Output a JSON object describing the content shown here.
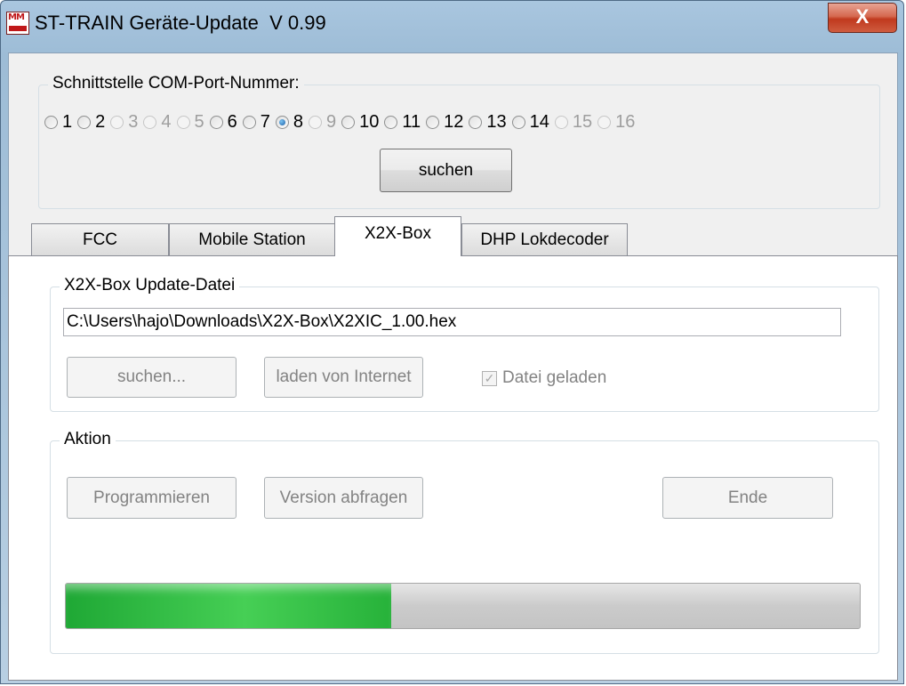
{
  "window": {
    "title": "ST-TRAIN Geräte-Update  V 0.99",
    "close_label": "X",
    "icon_text": "MM"
  },
  "com": {
    "group_label": "Schnittstelle COM-Port-Nummer:",
    "ports": [
      {
        "label": "1",
        "enabled": true,
        "checked": false
      },
      {
        "label": "2",
        "enabled": true,
        "checked": false
      },
      {
        "label": "3",
        "enabled": false,
        "checked": false
      },
      {
        "label": "4",
        "enabled": false,
        "checked": false
      },
      {
        "label": "5",
        "enabled": false,
        "checked": false
      },
      {
        "label": "6",
        "enabled": true,
        "checked": false
      },
      {
        "label": "7",
        "enabled": true,
        "checked": false
      },
      {
        "label": "8",
        "enabled": true,
        "checked": true
      },
      {
        "label": "9",
        "enabled": false,
        "checked": false
      },
      {
        "label": "10",
        "enabled": true,
        "checked": false
      },
      {
        "label": "11",
        "enabled": true,
        "checked": false
      },
      {
        "label": "12",
        "enabled": true,
        "checked": false
      },
      {
        "label": "13",
        "enabled": true,
        "checked": false
      },
      {
        "label": "14",
        "enabled": true,
        "checked": false
      },
      {
        "label": "15",
        "enabled": false,
        "checked": false
      },
      {
        "label": "16",
        "enabled": false,
        "checked": false
      }
    ],
    "search_label": "suchen"
  },
  "tabs": [
    {
      "label": "FCC",
      "active": false
    },
    {
      "label": "Mobile Station",
      "active": false
    },
    {
      "label": "X2X-Box",
      "active": true
    },
    {
      "label": "DHP Lokdecoder",
      "active": false
    }
  ],
  "update_file": {
    "group_label": "X2X-Box Update-Datei",
    "path": "C:\\Users\\hajo\\Downloads\\X2X-Box\\X2XIC_1.00.hex",
    "search_label": "suchen...",
    "internet_label": "laden von Internet",
    "loaded_label": "Datei geladen",
    "loaded_checked": true
  },
  "action": {
    "group_label": "Aktion",
    "program_label": "Programmieren",
    "version_label": "Version abfragen",
    "end_label": "Ende",
    "progress_fraction": 0.41
  },
  "colors": {
    "progress_green": "#2cb83f",
    "close_red": "#c0391e"
  }
}
